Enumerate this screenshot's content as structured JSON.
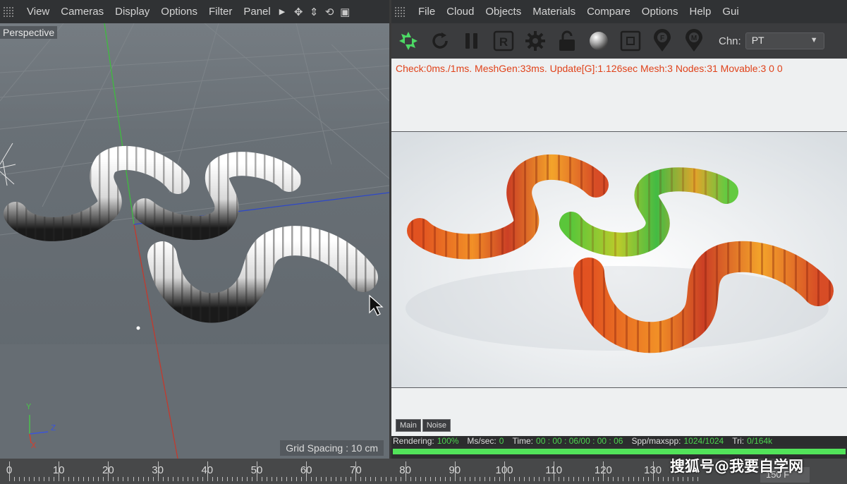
{
  "left_panel": {
    "menu": [
      "View",
      "Cameras",
      "Display",
      "Options",
      "Filter",
      "Panel"
    ],
    "viewport_label": "Perspective",
    "grid_spacing": "Grid Spacing : 10 cm",
    "axis_labels": {
      "y": "Y",
      "z": "Z",
      "x": "X"
    }
  },
  "right_panel": {
    "menu": [
      "File",
      "Cloud",
      "Objects",
      "Materials",
      "Compare",
      "Options",
      "Help",
      "Gui"
    ],
    "toolbar": {
      "buttons": [
        "render-start-icon",
        "refresh-icon",
        "pause-icon",
        "region-render-icon",
        "settings-gear-icon",
        "lock-icon",
        "material-sphere-icon",
        "frame-icon",
        "focus-pin-icon",
        "material-pin-icon"
      ],
      "button_letters": {
        "region": "R",
        "focus": "F",
        "material": "M"
      },
      "chn_label": "Chn:",
      "chn_value": "PT"
    },
    "status_line": "Check:0ms./1ms. MeshGen:33ms. Update[G]:1.126sec Mesh:3 Nodes:31 Movable:3  0 0",
    "bottom_tabs": [
      "Main",
      "Noise"
    ],
    "stats": {
      "rendering_label": "Rendering:",
      "rendering_value": "100%",
      "mssec_label": "Ms/sec:",
      "mssec_value": "0",
      "time_label": "Time:",
      "time_value": "00 : 00 : 06/00 : 00 : 06",
      "spp_label": "Spp/maxspp:",
      "spp_value": "1024/1024",
      "tri_label": "Tri:",
      "tri_value": "0/164k"
    },
    "progress": 1.0,
    "colors": {
      "status_text": "#e0421a",
      "stats_value": "#4cd24e",
      "progress": "#52e35a",
      "start_icon": "#4cd964"
    }
  },
  "timeline": {
    "ticks": [
      "0",
      "10",
      "20",
      "30",
      "40",
      "50",
      "60",
      "70",
      "80",
      "90",
      "100",
      "110",
      "120",
      "130"
    ],
    "end_frame": "150 F"
  },
  "watermark": "搜狐号@我要自学网"
}
